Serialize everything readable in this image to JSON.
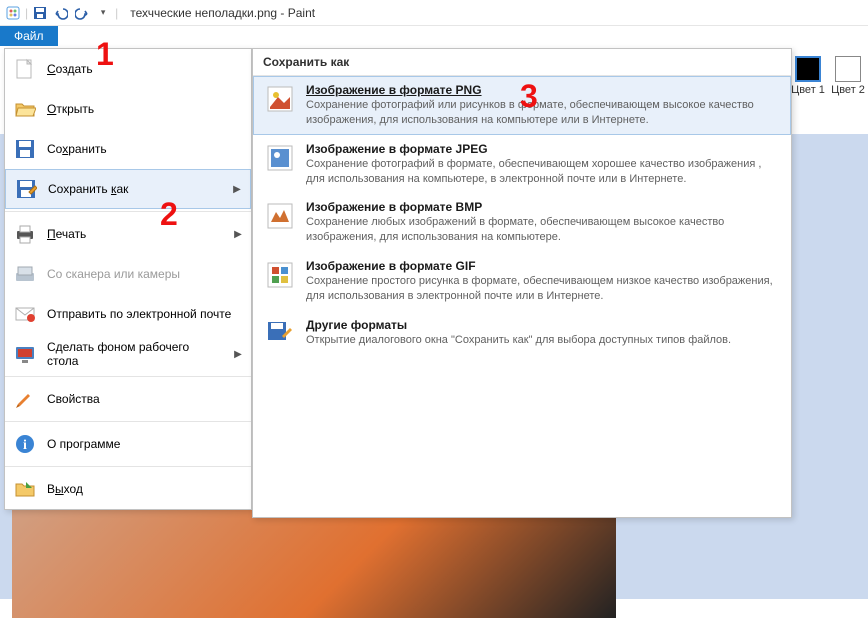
{
  "title": "техчческие неполадки.png - Paint",
  "file_tab": "Файл",
  "annotations": {
    "a1": "1",
    "a2": "2",
    "a3": "3"
  },
  "color_wells": {
    "c1": "Цвет 1",
    "c2": "Цвет 2"
  },
  "menu": [
    {
      "icon": "new",
      "label": "Создать",
      "accel": "С"
    },
    {
      "icon": "open",
      "label": "Открыть",
      "accel": "О"
    },
    {
      "icon": "save",
      "label": "Сохранить",
      "accel": "х"
    },
    {
      "icon": "saveas",
      "label": "Сохранить как",
      "accel": "к",
      "arrow": true,
      "selected": true
    },
    {
      "icon": "print",
      "label": "Печать",
      "accel": "П",
      "arrow": true
    },
    {
      "icon": "scanner",
      "label": "Со сканера или камеры",
      "disabled": true
    },
    {
      "icon": "email",
      "label": "Отправить по электронной почте"
    },
    {
      "icon": "wallpaper",
      "label": "Сделать фоном рабочего стола",
      "arrow": true
    },
    {
      "icon": "props",
      "label": "Свойства"
    },
    {
      "icon": "about",
      "label": "О программе"
    },
    {
      "icon": "exit",
      "label": "Выход",
      "accel": "ы"
    }
  ],
  "submenu_header": "Сохранить как",
  "formats": [
    {
      "icon": "png",
      "title": "Изображение в формате PNG",
      "desc": "Сохранение фотографий или рисунков в формате, обеспечивающем высокое качество изображения, для использования на компьютере или в Интернете.",
      "hover": true
    },
    {
      "icon": "jpeg",
      "title": "Изображение в формате JPEG",
      "desc": "Сохранение фотографий в формате, обеспечивающем хорошее качество изображения , для использования на компьютере, в электронной почте или в Интернете."
    },
    {
      "icon": "bmp",
      "title": "Изображение в формате BMP",
      "desc": "Сохранение любых изображений в формате, обеспечивающем высокое качество изображения, для использования на компьютере."
    },
    {
      "icon": "gif",
      "title": "Изображение в формате GIF",
      "desc": "Сохранение простого рисунка в формате, обеспечивающем низкое качество изображения, для использования в электронной почте или в Интернете."
    },
    {
      "icon": "other",
      "title": "Другие форматы",
      "desc": "Открытие диалогового окна \"Сохранить как\" для выбора доступных типов файлов."
    }
  ]
}
